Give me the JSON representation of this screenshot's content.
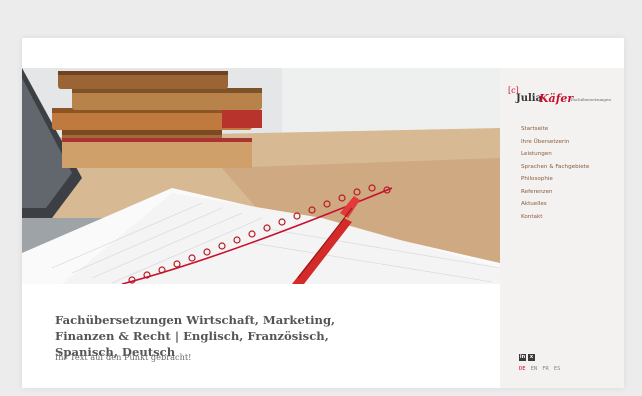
{
  "logo": {
    "bracket": "[c]",
    "first_name": "Julia",
    "last_name": "Käfer",
    "tagline": "Fachübersetzungen",
    "accent_color": "#c8102e"
  },
  "nav": {
    "items": [
      "Startseite",
      "Ihre Übersetzerin",
      "Leistungen",
      "Sprachen & Fachgebiete",
      "Philosophie",
      "Referenzen",
      "Aktuelles",
      "Kontakt"
    ]
  },
  "social": {
    "linkedin_label": "in",
    "xing_label": "x",
    "icons": [
      "linkedin-icon",
      "xing-icon"
    ]
  },
  "languages": {
    "items": [
      "DE",
      "EN",
      "FR",
      "ES"
    ],
    "active": "DE"
  },
  "main": {
    "title": "Fachübersetzungen Wirtschaft, Marketing, Finanzen & Recht | Englisch, Französisch, Spanisch, Deutsch",
    "subtitle": "Ihr Text auf den Punkt gebracht!"
  },
  "hero": {
    "image": "books-notebook-pen-photo"
  }
}
